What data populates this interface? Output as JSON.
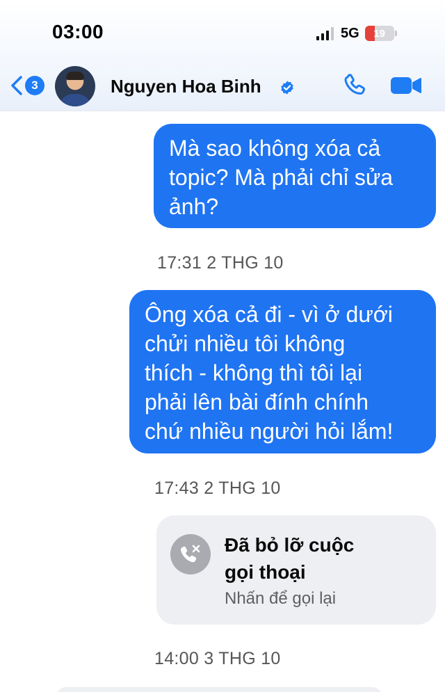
{
  "status_bar": {
    "time": "03:00",
    "network": "5G",
    "battery_level": "19",
    "battery_color": "#e5403b",
    "signal_icon": "cellular-signal-icon"
  },
  "header": {
    "back_badge_count": "3",
    "contact_name": "Nguyen Hoa Binh",
    "verified_icon": "verified-check-icon",
    "call_icon": "phone-icon",
    "video_icon": "video-camera-icon",
    "accent_color": "#1e7cf5"
  },
  "messages": [
    {
      "type": "outgoing",
      "lines": [
        "Mà sao không xóa cả",
        "topic? Mà phải chỉ sửa",
        "ảnh?"
      ]
    },
    {
      "type": "timestamp",
      "text": "17:31 2 THG 10"
    },
    {
      "type": "outgoing",
      "lines": [
        "Ông xóa cả đi - vì ở dưới",
        "chửi nhiều tôi không",
        "thích - không thì tôi lại",
        "phải lên bài đính chính",
        "chứ nhiều người hỏi lắm!"
      ]
    },
    {
      "type": "timestamp",
      "text": "17:43 2 THG 10"
    },
    {
      "type": "missed_call",
      "title_lines": [
        "Đã bỏ lỡ cuộc",
        "gọi thoại"
      ],
      "subtitle": "Nhấn để gọi lại",
      "icon": "missed-call-icon"
    },
    {
      "type": "timestamp",
      "text": "14:00 3 THG 10"
    }
  ],
  "colors": {
    "outgoing_bubble": "#1f74f2",
    "missed_call_card": "#eeeff2"
  }
}
